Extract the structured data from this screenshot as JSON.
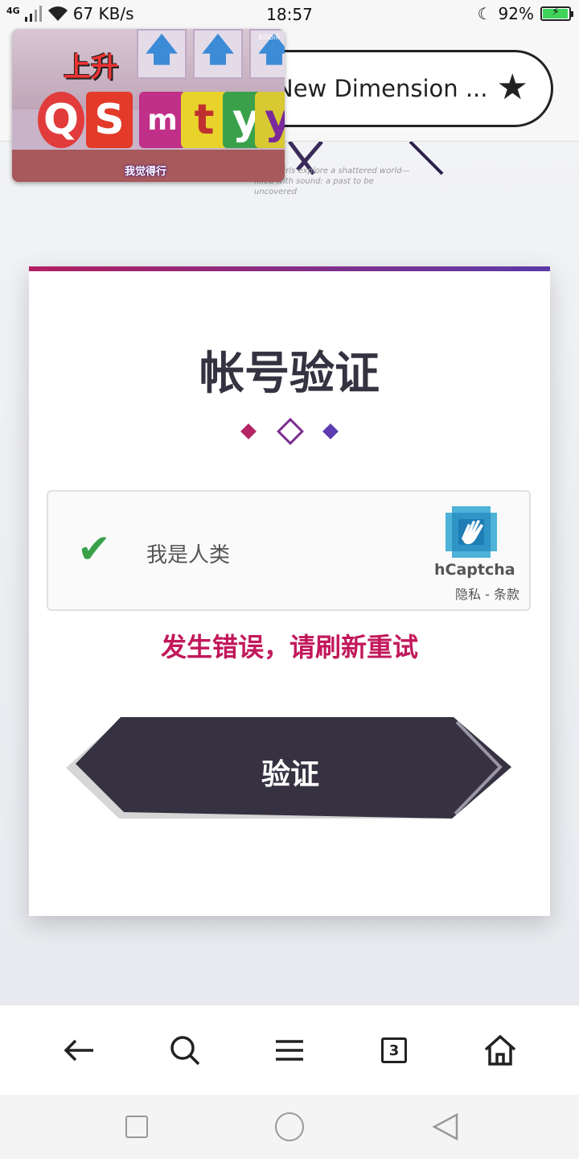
{
  "status_bar": {
    "network": "4G",
    "speed": "67 KB/s",
    "time": "18:57",
    "battery_percent": "92%"
  },
  "browser": {
    "url_title": "New Dimension ...",
    "bookmark_icon": "star-icon",
    "tab_count": "3"
  },
  "banner": {
    "tagline_line1": "girls explore a shattered world—",
    "tagline_line2": "filled with sound: a past to be uncovered"
  },
  "video": {
    "title": "上升",
    "letters": [
      "Q",
      "S",
      "m",
      "t",
      "y",
      "y"
    ],
    "caption": "我觉得行",
    "watermark": "bilibili"
  },
  "card": {
    "title": "帐号验证",
    "captcha": {
      "label": "我是人类",
      "brand": "hCaptcha",
      "links": "隐私 - 条款"
    },
    "error": "发生错误，请刷新重试",
    "verify_button": "验证"
  },
  "colors": {
    "accent_magenta": "#b21f62",
    "accent_purple": "#5a3aa8",
    "error": "#c2185b",
    "button_dark": "#363241",
    "check_green": "#3aa14a"
  },
  "bottom_nav": {
    "icons": [
      "back-arrow-icon",
      "search-icon",
      "menu-icon",
      "tabs-icon",
      "home-icon"
    ]
  }
}
